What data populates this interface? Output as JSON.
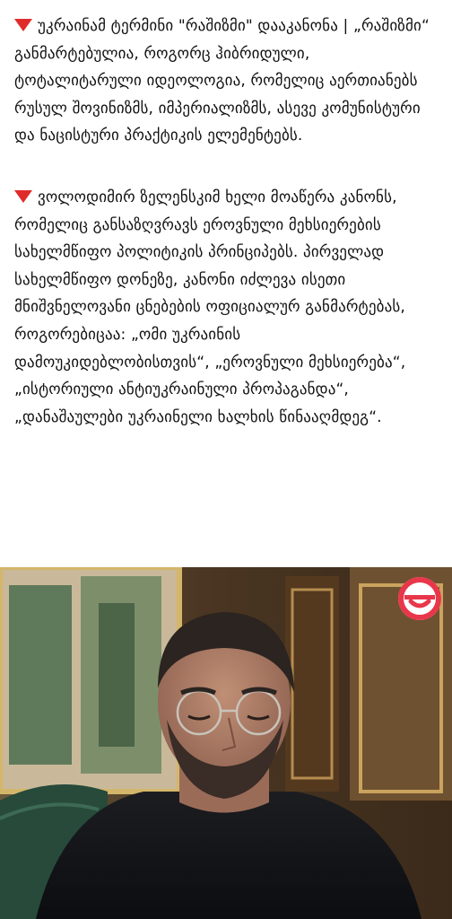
{
  "post": {
    "paragraphs": [
      {
        "icon": "red-triangle-down-icon",
        "text": "უკრაინამ ტერმინი \"რაშიზმი\" დააკანონა | „რაშიზმი“ განმარტებულია, როგორც ჰიბრიდული, ტოტალიტარული იდეოლოგია, რომელიც აერთიანებს რუსულ შოვინიზმს, იმპერიალიზმს, ასევე კომუნისტური და ნაცისტური პრაქტიკის ელემენტებს."
      },
      {
        "icon": "red-triangle-down-icon",
        "text": "ვოლოდიმირ ზელენსკიმ ხელი მოაწერა კანონს, რომელიც განსაზღვრავს ეროვნული მეხსიერების სახელმწიფო პოლიტიკის პრინციპებს. პირველად სახელმწიფო დონეზე, კანონი იძლევა ისეთი მნიშვნელოვანი ცნებების ოფიციალურ განმარტებას, როგორებიცაა: „ომი უკრაინის დამოუკიდებლობისთვის“, „ეროვნული მეხსიერება“, „ისტორიული ანტიუკრაინული პროპაგანდა“, „დანაშაულები უკრაინელი ხალხის წინააღმდეგ“."
      }
    ]
  },
  "photo": {
    "logo_icon": "smile-logo-icon",
    "colors": {
      "logo_ring": "#e8374b",
      "shirt": "#141518",
      "skin": "#b0806a",
      "hair": "#2b2420",
      "wood": "#5a4028",
      "window_green": "#5f7a5a",
      "chair": "#274a3a"
    }
  }
}
